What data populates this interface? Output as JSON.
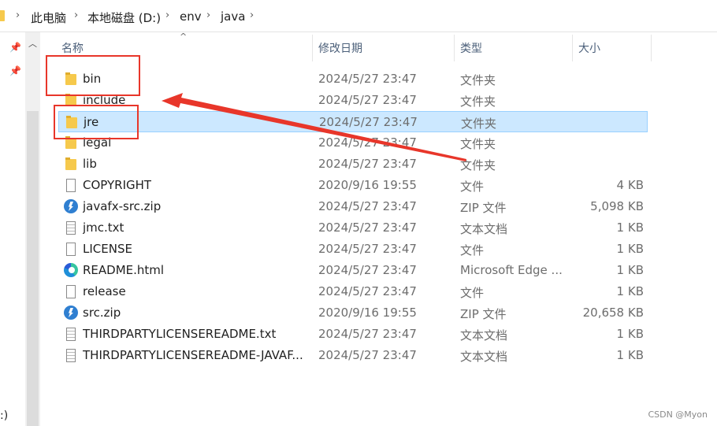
{
  "breadcrumbs": [
    "此电脑",
    "本地磁盘 (D:)",
    "env",
    "java"
  ],
  "columns": {
    "name": "名称",
    "date": "修改日期",
    "type": "类型",
    "size": "大小"
  },
  "left_pane_fragment": ":)",
  "files": [
    {
      "name": "bin",
      "date": "2024/5/27 23:47",
      "type": "文件夹",
      "size": "",
      "icon": "folder-icon"
    },
    {
      "name": "include",
      "date": "2024/5/27 23:47",
      "type": "文件夹",
      "size": "",
      "icon": "folder-icon"
    },
    {
      "name": "jre",
      "date": "2024/5/27 23:47",
      "type": "文件夹",
      "size": "",
      "icon": "folder-icon",
      "selected": true
    },
    {
      "name": "legal",
      "date": "2024/5/27 23:47",
      "type": "文件夹",
      "size": "",
      "icon": "folder-icon"
    },
    {
      "name": "lib",
      "date": "2024/5/27 23:47",
      "type": "文件夹",
      "size": "",
      "icon": "folder-icon"
    },
    {
      "name": "COPYRIGHT",
      "date": "2020/9/16 19:55",
      "type": "文件",
      "size": "4 KB",
      "icon": "file-icon"
    },
    {
      "name": "javafx-src.zip",
      "date": "2024/5/27 23:47",
      "type": "ZIP 文件",
      "size": "5,098 KB",
      "icon": "zip-icon"
    },
    {
      "name": "jmc.txt",
      "date": "2024/5/27 23:47",
      "type": "文本文档",
      "size": "1 KB",
      "icon": "text-file-icon"
    },
    {
      "name": "LICENSE",
      "date": "2024/5/27 23:47",
      "type": "文件",
      "size": "1 KB",
      "icon": "file-icon"
    },
    {
      "name": "README.html",
      "date": "2024/5/27 23:47",
      "type": "Microsoft Edge ...",
      "size": "1 KB",
      "icon": "edge-icon"
    },
    {
      "name": "release",
      "date": "2024/5/27 23:47",
      "type": "文件",
      "size": "1 KB",
      "icon": "file-icon"
    },
    {
      "name": "src.zip",
      "date": "2020/9/16 19:55",
      "type": "ZIP 文件",
      "size": "20,658 KB",
      "icon": "zip-icon"
    },
    {
      "name": "THIRDPARTYLICENSEREADME.txt",
      "date": "2024/5/27 23:47",
      "type": "文本文档",
      "size": "1 KB",
      "icon": "text-file-icon"
    },
    {
      "name": "THIRDPARTYLICENSEREADME-JAVAF...",
      "date": "2024/5/27 23:47",
      "type": "文本文档",
      "size": "1 KB",
      "icon": "text-file-icon"
    }
  ],
  "annotation_color": "#e8362a",
  "selection_color": "#cce8ff",
  "watermark": "CSDN @Myon⁠"
}
